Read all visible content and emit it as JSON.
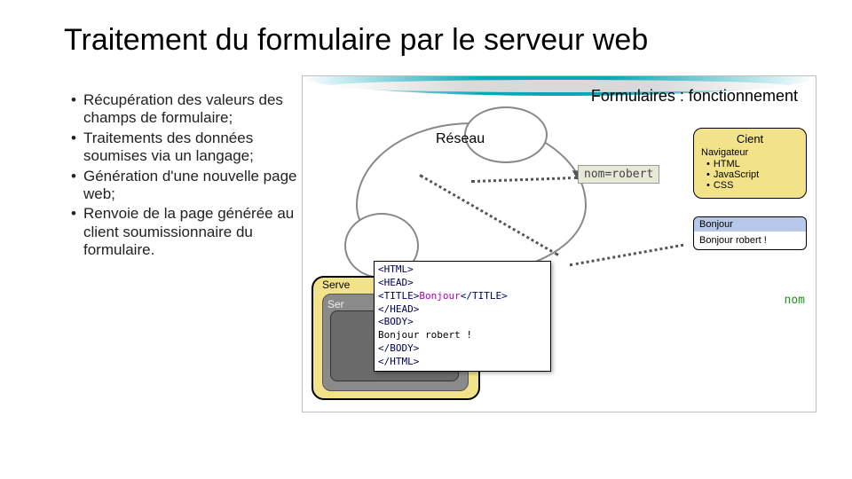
{
  "title": "Traitement du formulaire par le serveur web",
  "bullets": [
    "Récupération des valeurs des champs de formulaire;",
    "Traitements des données soumises via un langage;",
    "Génération d'une nouvelle page web;",
    "Renvoie de la page générée au client soumissionnaire du formulaire."
  ],
  "diagram": {
    "heading": "Formulaires : fonctionnement",
    "cloud_label": "Réseau",
    "request_data": "nom=robert",
    "client": {
      "title": "Cient",
      "subtitle": "Navigateur",
      "items": [
        "HTML",
        "JavaScript",
        "CSS"
      ]
    },
    "response_box": {
      "header": "Bonjour",
      "body": "Bonjour robert !"
    },
    "server_outer": "Serve",
    "server_inner": "Ser",
    "code": {
      "l1": "<HTML>",
      "l2": "<HEAD>",
      "l3a": "<TITLE>",
      "l3b": "Bonjour",
      "l3c": "</TITLE>",
      "l4": "</HEAD>",
      "l5": "<BODY>",
      "l6": "Bonjour robert !",
      "l7": "</BODY>",
      "l8": "</HTML>"
    },
    "var_label": "nom"
  }
}
